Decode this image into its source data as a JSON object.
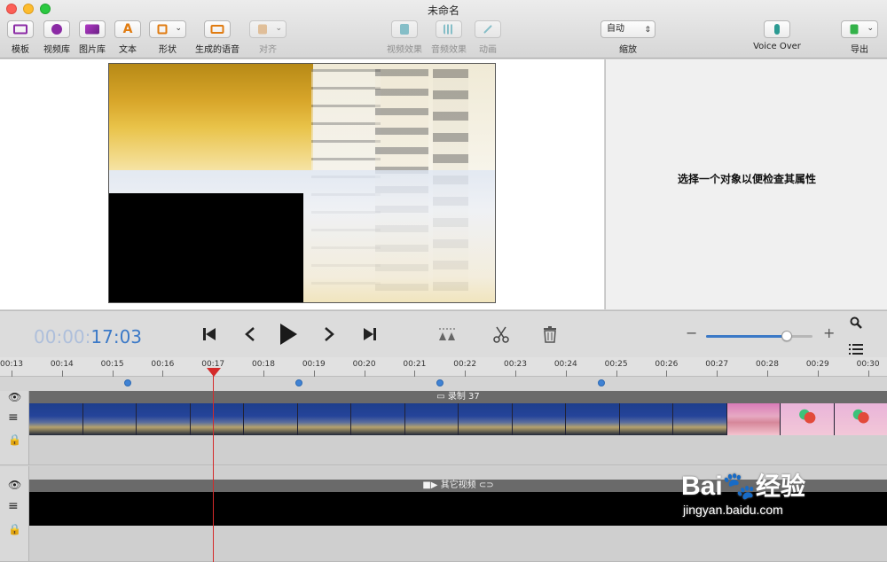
{
  "window": {
    "title": "未命名"
  },
  "toolbar": {
    "items": [
      {
        "label": "模板"
      },
      {
        "label": "视频库"
      },
      {
        "label": "图片库"
      },
      {
        "label": "文本"
      },
      {
        "label": "形状"
      },
      {
        "label": "生成的语音"
      },
      {
        "label": "对齐"
      },
      {
        "label": "视频效果"
      },
      {
        "label": "音频效果"
      },
      {
        "label": "动画"
      },
      {
        "label": "缩放"
      },
      {
        "label": "Voice Over"
      },
      {
        "label": "导出"
      }
    ],
    "zoom_value": "自动",
    "text_icon": "A"
  },
  "inspector": {
    "message": "选择一个对象以便检查其属性"
  },
  "playback": {
    "timecode_dim": "00:00:",
    "timecode_bright": "17:03",
    "buttons": [
      "skip-start-icon",
      "step-back-icon",
      "play-icon",
      "step-forward-icon",
      "skip-end-icon",
      "split-markers-icon",
      "cut-icon",
      "trash-icon"
    ],
    "zoom_minus": "−",
    "zoom_plus": "+",
    "zoom_level": 0.76
  },
  "timeline": {
    "ticks": [
      "00:13",
      "00:14",
      "00:15",
      "00:16",
      "00:17",
      "00:18",
      "00:19",
      "00:20",
      "00:21",
      "00:22",
      "00:23",
      "00:24",
      "00:25",
      "00:26",
      "00:27",
      "00:28",
      "00:29",
      "00:30"
    ],
    "playhead": "00:17",
    "marker_times": [
      "00:15.3",
      "00:18.7",
      "00:21.5",
      "00:24.7"
    ],
    "tracks": [
      {
        "title": "录制 37"
      },
      {
        "title": "其它视频"
      }
    ]
  },
  "watermark": {
    "brand": "Bai",
    "brand2": "经验",
    "url": "jingyan.baidu.com"
  },
  "colors": {
    "accent": "#3b79c7",
    "playhead": "#d42a2a",
    "marker": "#3f82d4"
  }
}
